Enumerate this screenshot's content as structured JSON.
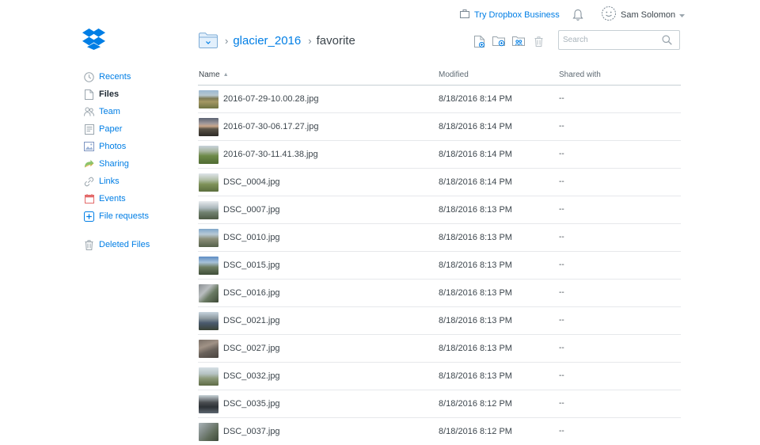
{
  "colors": {
    "accent": "#007ee5",
    "text": "#3d464d",
    "muted": "#7b8994"
  },
  "topbar": {
    "try_business_label": "Try Dropbox Business",
    "user_name": "Sam Solomon"
  },
  "sidebar": {
    "items": [
      {
        "label": "Recents",
        "icon": "clock-icon"
      },
      {
        "label": "Files",
        "icon": "file-icon"
      },
      {
        "label": "Team",
        "icon": "team-icon"
      },
      {
        "label": "Paper",
        "icon": "paper-icon"
      },
      {
        "label": "Photos",
        "icon": "photos-icon"
      },
      {
        "label": "Sharing",
        "icon": "sharing-icon"
      },
      {
        "label": "Links",
        "icon": "link-icon"
      },
      {
        "label": "Events",
        "icon": "calendar-icon"
      },
      {
        "label": "File requests",
        "icon": "file-request-icon"
      },
      {
        "label": "Deleted Files",
        "icon": "trash-icon"
      }
    ]
  },
  "breadcrumb": {
    "root": "glacier_2016",
    "current": "favorite"
  },
  "search": {
    "placeholder": "Search"
  },
  "table": {
    "columns": {
      "name": "Name",
      "modified": "Modified",
      "shared": "Shared with"
    },
    "rows": [
      {
        "name": "2016-07-29-10.00.28.jpg",
        "modified": "8/18/2016 8:14 PM",
        "shared": "--"
      },
      {
        "name": "2016-07-30-06.17.27.jpg",
        "modified": "8/18/2016 8:14 PM",
        "shared": "--"
      },
      {
        "name": "2016-07-30-11.41.38.jpg",
        "modified": "8/18/2016 8:14 PM",
        "shared": "--"
      },
      {
        "name": "DSC_0004.jpg",
        "modified": "8/18/2016 8:14 PM",
        "shared": "--"
      },
      {
        "name": "DSC_0007.jpg",
        "modified": "8/18/2016 8:13 PM",
        "shared": "--"
      },
      {
        "name": "DSC_0010.jpg",
        "modified": "8/18/2016 8:13 PM",
        "shared": "--"
      },
      {
        "name": "DSC_0015.jpg",
        "modified": "8/18/2016 8:13 PM",
        "shared": "--"
      },
      {
        "name": "DSC_0016.jpg",
        "modified": "8/18/2016 8:13 PM",
        "shared": "--"
      },
      {
        "name": "DSC_0021.jpg",
        "modified": "8/18/2016 8:13 PM",
        "shared": "--"
      },
      {
        "name": "DSC_0027.jpg",
        "modified": "8/18/2016 8:13 PM",
        "shared": "--"
      },
      {
        "name": "DSC_0032.jpg",
        "modified": "8/18/2016 8:13 PM",
        "shared": "--"
      },
      {
        "name": "DSC_0035.jpg",
        "modified": "8/18/2016 8:12 PM",
        "shared": "--"
      },
      {
        "name": "DSC_0037.jpg",
        "modified": "8/18/2016 8:12 PM",
        "shared": "--"
      }
    ]
  }
}
